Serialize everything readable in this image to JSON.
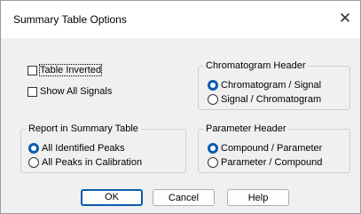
{
  "window": {
    "title": "Summary Table Options",
    "close_glyph": "✕"
  },
  "options": {
    "table_inverted": {
      "label": "Table Inverted",
      "checked": false
    },
    "show_all_signals": {
      "label": "Show All Signals",
      "checked": false
    }
  },
  "chromatogram_header": {
    "label": "Chromatogram Header",
    "options": [
      "Chromatogram / Signal",
      "Signal / Chromatogram"
    ],
    "selected": 0
  },
  "report": {
    "label": "Report in Summary Table",
    "options": [
      "All Identified Peaks",
      "All Peaks in Calibration"
    ],
    "selected": 0
  },
  "parameter_header": {
    "label": "Parameter Header",
    "options": [
      "Compound / Parameter",
      "Parameter / Compound"
    ],
    "selected": 0
  },
  "buttons": {
    "ok": "OK",
    "cancel": "Cancel",
    "help": "Help"
  },
  "colors": {
    "accent": "#0b5cad",
    "dialog_bg": "#f0f0f0"
  },
  "icons": {
    "close": "close-icon"
  }
}
